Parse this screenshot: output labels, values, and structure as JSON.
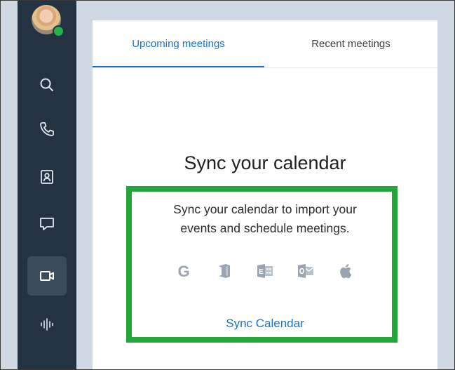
{
  "sidebar": {
    "avatar_alt": "User avatar",
    "status": "online",
    "items": [
      {
        "name": "search",
        "icon": "search-icon"
      },
      {
        "name": "calls",
        "icon": "phone-icon"
      },
      {
        "name": "contacts",
        "icon": "contact-card-icon"
      },
      {
        "name": "chat",
        "icon": "chat-bubble-icon"
      },
      {
        "name": "meetings",
        "icon": "video-camera-icon",
        "active": true
      },
      {
        "name": "voicemail",
        "icon": "audio-wave-icon"
      }
    ]
  },
  "tabs": [
    {
      "label": "Upcoming meetings",
      "active": true
    },
    {
      "label": "Recent meetings",
      "active": false
    }
  ],
  "main": {
    "title": "Sync your calendar",
    "description_line1": "Sync your calendar to import your",
    "description_line2": "events and schedule meetings.",
    "calendar_icons": [
      "google-icon",
      "office-icon",
      "exchange-icon",
      "outlook-icon",
      "apple-icon"
    ],
    "sync_link": "Sync Calendar"
  },
  "colors": {
    "accent": "#1a73c9",
    "sidebar_bg": "#233342",
    "highlight": "#24a53a",
    "icon_gray": "#9aa5b1"
  }
}
